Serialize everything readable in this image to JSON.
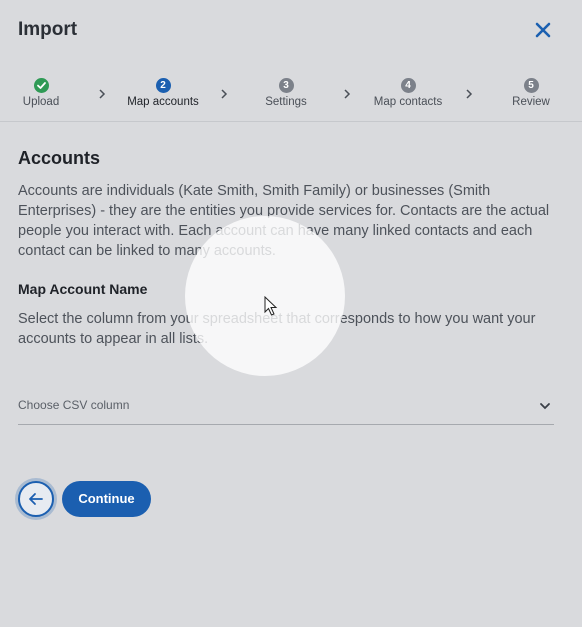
{
  "header": {
    "title": "Import"
  },
  "stepper": {
    "steps": [
      {
        "number": "✓",
        "label": "Upload",
        "state": "done"
      },
      {
        "number": "2",
        "label": "Map accounts",
        "state": "active"
      },
      {
        "number": "3",
        "label": "Settings",
        "state": "todo"
      },
      {
        "number": "4",
        "label": "Map contacts",
        "state": "todo"
      },
      {
        "number": "5",
        "label": "Review",
        "state": "todo"
      }
    ]
  },
  "main": {
    "heading": "Accounts",
    "description": "Accounts are individuals (Kate Smith, Smith Family) or businesses (Smith Enterprises) - they are the entities you provide services for. Contacts are the actual people you interact with. Each account can have many linked contacts and each contact can be linked to many accounts.",
    "subheading": "Map Account Name",
    "subdescription": "Select the column from your spreadsheet that corresponds to how you want your accounts to appear in all lists.",
    "select": {
      "placeholder": "Choose CSV column"
    }
  },
  "footer": {
    "back_icon": "arrow-left-icon",
    "continue_label": "Continue"
  },
  "colors": {
    "accent": "#1b5fb0",
    "success": "#2f9a55",
    "background": "#d9dadd"
  }
}
